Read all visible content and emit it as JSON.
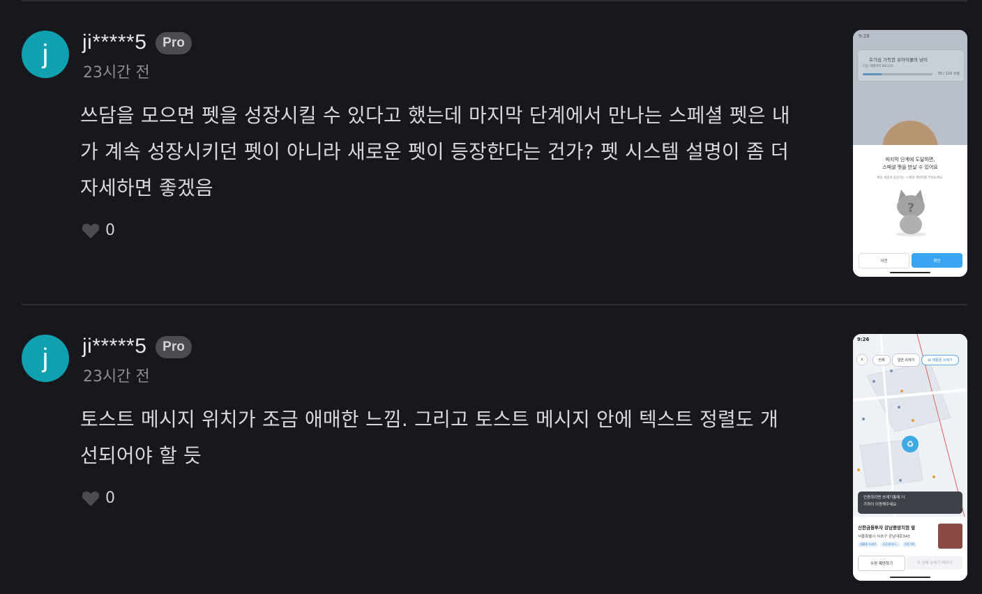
{
  "comments": [
    {
      "avatar_letter": "j",
      "username": "ji*****5",
      "badge": "Pro",
      "time": "23시간 전",
      "text_lines": [
        "쓰담을 모으면 펫을 성장시킬 수 있다고 했는데 마지막 단계에서 만나는 스페셜 펫은 내",
        "가 계속 성장시키던 펫이 아니라 새로운 펫이 등장한다는 건가? 펫 시스템 설명이 좀 더",
        "자세하면 좋겠음"
      ],
      "likes": "0",
      "screenshot": {
        "status_time": "9:28",
        "card_title": "호기심 가득한 유아이몰의 냥이",
        "card_sub": "다음 레벨까지 80/110",
        "progress": "30 / 110 쓰담",
        "progress_fraction": 0.27,
        "sheet_title": "마지막 단계에 도달하면,\n스페셜 펫을 만날 수 있어요",
        "sheet_sub": "매일 새롭게 등장하는 스페셜 캐릭터를 키워보세요.",
        "btn_prev": "이전",
        "btn_ok": "확인"
      }
    },
    {
      "avatar_letter": "j",
      "username": "ji*****5",
      "badge": "Pro",
      "time": "23시간 전",
      "text_lines": [
        "토스트 메시지 위치가 조금 애매한 느낌. 그리고 토스트 메시지 안에 텍스트 정렬도 개",
        "선되어야 할 듯"
      ],
      "likes": "0",
      "screenshot": {
        "status_time": "9:26",
        "chip_all": "전체",
        "chip_general": "일반 쓰레기",
        "chip_recycle": "♻ 재활용 쓰레기",
        "toast": "인증하려면 쓰레기통에 더\n가까이 이동해주세요.",
        "place_name": "신한금융투자 강남중앙지점 앞",
        "place_addr": "서울특별시 서초구 강남대로343",
        "tags": [
          "재활용 쓰레기",
          "공공데이터...",
          "인증 0회"
        ],
        "btn_edit": "수정 제안하기",
        "btn_throw": "이 곳에 쓰레기 버리기"
      }
    }
  ],
  "colors": {
    "background": "#17181d",
    "avatar": "#10a0b0",
    "badge": "#4a4c52",
    "accent_blue": "#3aa4f0"
  }
}
